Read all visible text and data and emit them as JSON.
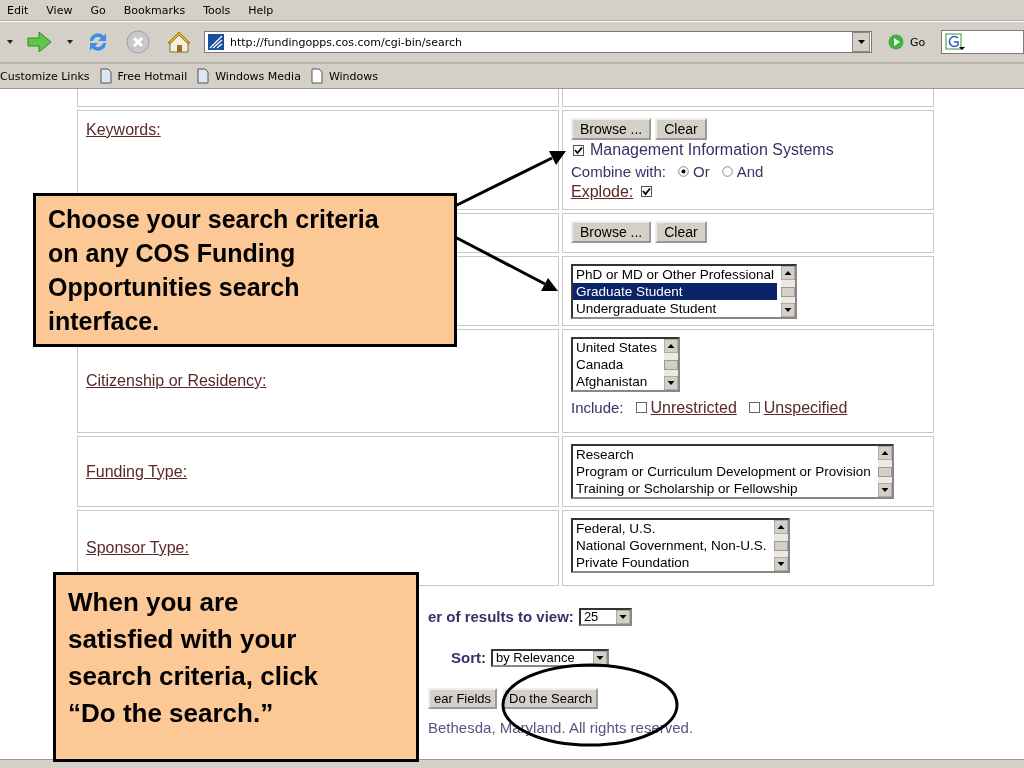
{
  "menu": [
    "Edit",
    "View",
    "Go",
    "Bookmarks",
    "Tools",
    "Help"
  ],
  "toolbar": {
    "address": "http://fundingopps.cos.com/cgi-bin/search",
    "go": "Go"
  },
  "links": [
    {
      "label": "Customize Links",
      "kind": "text"
    },
    {
      "label": "Free Hotmail",
      "kind": "page"
    },
    {
      "label": "Windows Media",
      "kind": "page"
    },
    {
      "label": "Windows",
      "kind": "blank"
    }
  ],
  "form": {
    "rows": [
      {
        "kind": "blank"
      },
      {
        "kind": "keywords",
        "label": "Keywords:",
        "buttons": [
          "Browse ...",
          "Clear"
        ],
        "term": {
          "label": "Management Information Systems",
          "checked": true
        },
        "combine": {
          "label": "Combine with:",
          "options": [
            {
              "label": "Or",
              "selected": true
            },
            {
              "label": "And",
              "selected": false
            }
          ]
        },
        "explode": {
          "label": "Explode:",
          "checked": true
        }
      },
      {
        "kind": "buttons",
        "buttons": [
          "Browse ...",
          "Clear"
        ]
      },
      {
        "kind": "list",
        "items": [
          {
            "label": "PhD or MD or Other Professional",
            "selected": false
          },
          {
            "label": "Graduate Student",
            "selected": true
          },
          {
            "label": "Undergraduate Student",
            "selected": false
          }
        ]
      },
      {
        "kind": "list",
        "label": "Citizenship or Residency:",
        "items": [
          {
            "label": "United States",
            "selected": false
          },
          {
            "label": "Canada",
            "selected": false
          },
          {
            "label": "Afghanistan",
            "selected": false
          }
        ],
        "include": {
          "label": "Include:",
          "options": [
            {
              "label": "Unrestricted",
              "checked": false
            },
            {
              "label": "Unspecified",
              "checked": false
            }
          ]
        }
      },
      {
        "kind": "list",
        "label": "Funding Type:",
        "items": [
          {
            "label": "Research",
            "selected": false
          },
          {
            "label": "Program or Curriculum Development or Provision",
            "selected": false
          },
          {
            "label": "Training or Scholarship or Fellowship",
            "selected": false
          }
        ]
      },
      {
        "kind": "list",
        "label": "Sponsor Type:",
        "items": [
          {
            "label": "Federal, U.S.",
            "selected": false
          },
          {
            "label": "National Government, Non-U.S.",
            "selected": false
          },
          {
            "label": "Private Foundation",
            "selected": false
          }
        ]
      }
    ],
    "results": {
      "label": "er of results to view:",
      "value": "25"
    },
    "sort": {
      "label": "Sort:",
      "value": "by Relevance"
    },
    "buttons": [
      "ear Fields",
      "Do the Search"
    ],
    "footer": "Bethesda, Maryland. All rights reserved."
  },
  "callouts": [
    {
      "text": "Choose your search criteria on any COS Funding Opportunities search interface."
    },
    {
      "text": "When you are satisfied with your search criteria, click “Do the search.”"
    }
  ]
}
